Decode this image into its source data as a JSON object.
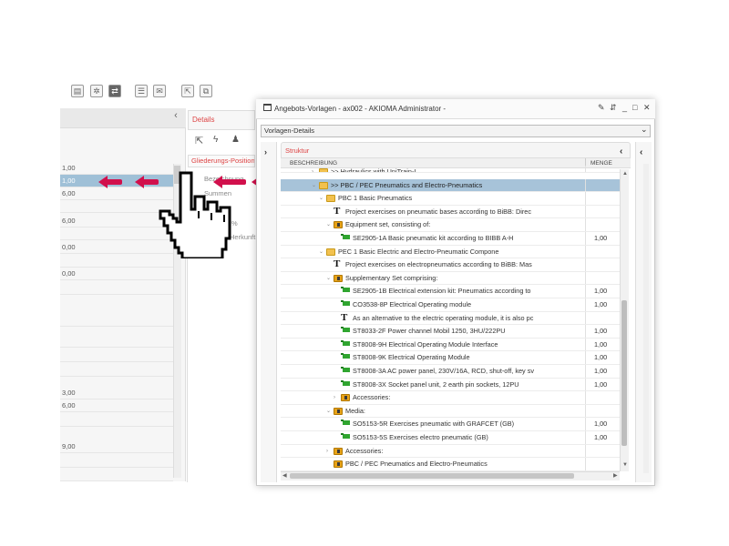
{
  "background": {
    "toolbar_icons": [
      "clipboard-icon",
      "gear-icon",
      "settings-icon",
      "user-icon",
      "mail-icon",
      "export-icon",
      "copy-icon"
    ],
    "left_panel": {
      "collapse_glyph": "‹",
      "values": [
        "1,00",
        "1,00",
        "6,00",
        "6,00",
        "0,00",
        "0,00",
        "3,00",
        "6,00",
        "9,00"
      ]
    },
    "details": {
      "title": "Details",
      "gliederung": "Gliederungs-Position",
      "labels": [
        "Bezeichnung",
        "Summen",
        "%",
        "Herkunft"
      ]
    }
  },
  "dialog": {
    "title": "Angebots-Vorlagen - ax002 - AKIOMA Administrator -",
    "window_buttons": [
      "✎",
      "⇵",
      "_",
      "□",
      "✕"
    ],
    "tab": "Vorlagen-Details",
    "panel_title": "Struktur",
    "columns": {
      "description": "BESCHREIBUNG",
      "quantity": "MENGE"
    },
    "rows": [
      {
        "label": ">> Hydraulics with UniTrain-I",
        "icon": "folder",
        "toggle": "›",
        "qty": ""
      },
      {
        "label": ">> PBC / PEC Pneumatics and Electro-Pneumatics",
        "icon": "folder",
        "toggle": "⌄",
        "qty": ""
      },
      {
        "label": "PBC 1 Basic Pneumatics",
        "icon": "folder",
        "toggle": "⌄",
        "qty": ""
      },
      {
        "label": "Project exercises on pneumatic bases according to BiBB: Direc",
        "icon": "text",
        "toggle": "",
        "qty": ""
      },
      {
        "label": "Equipment set, consisting of:",
        "icon": "group",
        "toggle": "⌄",
        "qty": ""
      },
      {
        "label": "SE2905-1A Basic pneumatic kit according to BIBB A-H",
        "icon": "cart",
        "toggle": "",
        "qty": "1,00"
      },
      {
        "label": "PEC 1 Basic Electric and Electro-Pneumatic Compone",
        "icon": "folder",
        "toggle": "⌄",
        "qty": ""
      },
      {
        "label": "Project exercises on electropneumatics according to BiBB: Mas",
        "icon": "text",
        "toggle": "",
        "qty": ""
      },
      {
        "label": "Supplementary Set comprising:",
        "icon": "group",
        "toggle": "⌄",
        "qty": ""
      },
      {
        "label": "SE2905-1B Electrical extension kit: Pneumatics according to",
        "icon": "cart",
        "toggle": "",
        "qty": "1,00"
      },
      {
        "label": "CO3538-8P Electrical Operating module",
        "icon": "cart",
        "toggle": "",
        "qty": "1,00"
      },
      {
        "label": "As an alternative to the electric operating module, it is also pc",
        "icon": "text",
        "toggle": "",
        "qty": ""
      },
      {
        "label": "ST8033-2F Power channel Mobil 1250, 3HU/222PU",
        "icon": "cart",
        "toggle": "",
        "qty": "1,00"
      },
      {
        "label": "ST8008-9H Electrical Operating Module Interface",
        "icon": "cart",
        "toggle": "",
        "qty": "1,00"
      },
      {
        "label": "ST8008-9K Electrical Operating Module",
        "icon": "cart",
        "toggle": "",
        "qty": "1,00"
      },
      {
        "label": "ST8008-3A AC power panel, 230V/16A, RCD, shut-off, key sv",
        "icon": "cart",
        "toggle": "",
        "qty": "1,00"
      },
      {
        "label": "ST8008-3X Socket panel unit, 2 earth pin sockets, 12PU",
        "icon": "cart",
        "toggle": "",
        "qty": "1,00"
      },
      {
        "label": "Accessories:",
        "icon": "group",
        "toggle": "›",
        "qty": ""
      },
      {
        "label": "Media:",
        "icon": "group",
        "toggle": "⌄",
        "qty": ""
      },
      {
        "label": "SO5153-5R Exercises pneumatic with GRAFCET (GB)",
        "icon": "cart",
        "toggle": "",
        "qty": "1,00"
      },
      {
        "label": "SO5153-5S Exercises electro pneumatic (GB)",
        "icon": "cart",
        "toggle": "",
        "qty": "1,00"
      },
      {
        "label": "Accessories:",
        "icon": "group",
        "toggle": "›",
        "qty": ""
      },
      {
        "label": "PBC / PEC Pneumatics and Electro-Pneumatics",
        "icon": "group",
        "toggle": "",
        "qty": ""
      }
    ],
    "selected_row": 1
  },
  "colors": {
    "accent": "#d1104c",
    "selection": "#a7c3d9",
    "panel_title": "#dd4444"
  }
}
